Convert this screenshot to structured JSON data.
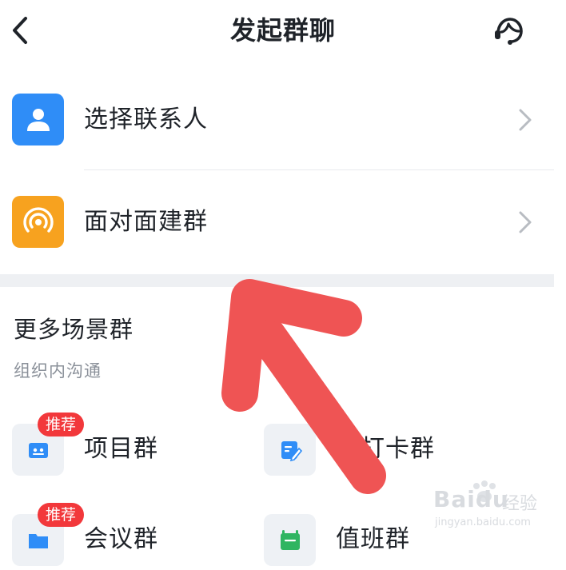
{
  "header": {
    "title": "发起群聊",
    "back_icon": "chevron-left-icon",
    "support_icon": "customer-service-icon"
  },
  "top_list": {
    "items": [
      {
        "label": "选择联系人",
        "icon": "contact-person-icon",
        "icon_color": "#2f8df7"
      },
      {
        "label": "面对面建群",
        "icon": "face-to-face-signal-icon",
        "icon_color": "#f7a21f"
      }
    ]
  },
  "more_scenes": {
    "title": "更多场景群",
    "subtitle": "组织内沟通",
    "items": [
      {
        "label": "项目群",
        "badge": "推荐",
        "icon": "project-group-icon",
        "icon_color": "#2f8df7"
      },
      {
        "label": "到打卡群",
        "icon": "checkin-edit-icon",
        "icon_color": "#2f8df7"
      },
      {
        "label": "会议群",
        "badge": "推荐",
        "icon": "meeting-folder-icon",
        "icon_color": "#2f8df7"
      },
      {
        "label": "值班群",
        "icon": "duty-calendar-icon",
        "icon_color": "#2fb561"
      }
    ]
  },
  "annotation": {
    "arrow_color": "#ef5454"
  },
  "watermark": {
    "brand": "Baidu",
    "suffix": "经验",
    "url": "jingyan.baidu.com"
  }
}
